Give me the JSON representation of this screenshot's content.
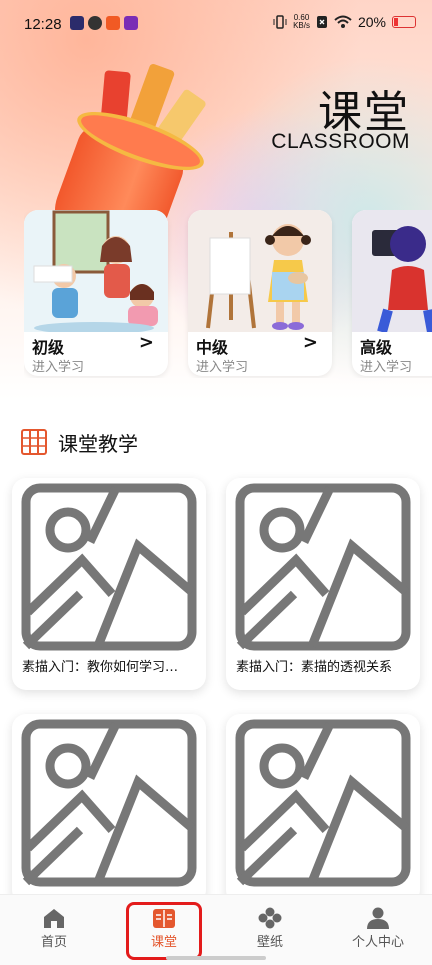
{
  "status_bar": {
    "time": "12:28",
    "net_speed": "0.60",
    "net_unit": "KB/s",
    "battery": "20%"
  },
  "hero": {
    "title": "课堂",
    "subtitle": "CLASSROOM"
  },
  "levels": [
    {
      "name": "初级",
      "hint": "进入学习",
      "arrow": ">"
    },
    {
      "name": "中级",
      "hint": "进入学习",
      "arrow": ">"
    },
    {
      "name": "高级",
      "hint": "进入学习",
      "arrow": ">"
    }
  ],
  "section": {
    "title": "课堂教学"
  },
  "lessons": [
    {
      "title": "素描入门：教你如何学习…"
    },
    {
      "title": "素描入门：素描的透视关系"
    },
    {
      "title": ""
    },
    {
      "title": ""
    }
  ],
  "tabbar": {
    "items": [
      {
        "label": "首页",
        "icon": "home-icon"
      },
      {
        "label": "课堂",
        "icon": "book-icon"
      },
      {
        "label": "壁纸",
        "icon": "flower-icon"
      },
      {
        "label": "个人中心",
        "icon": "person-icon"
      }
    ],
    "active_index": 1
  },
  "colors": {
    "accent": "#e4572e",
    "highlight": "#e31b1b"
  }
}
